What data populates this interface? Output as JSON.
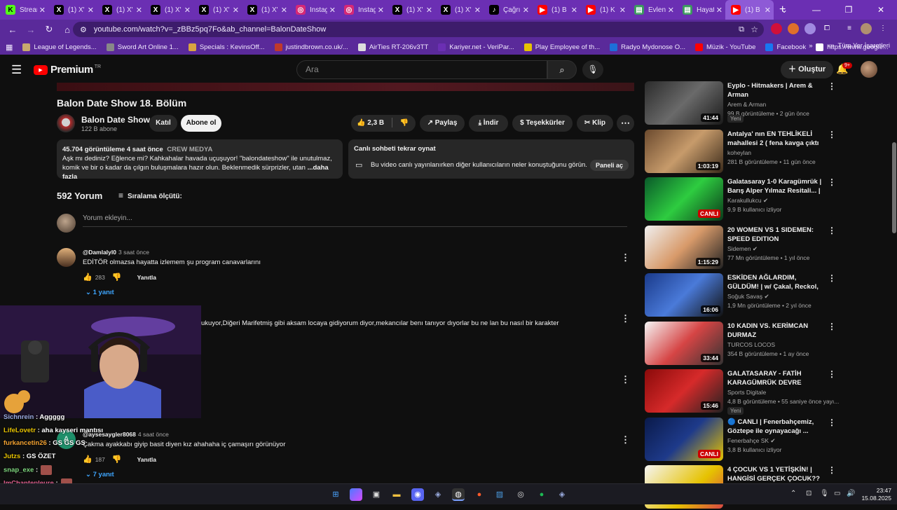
{
  "browser": {
    "tabs": [
      {
        "label": "Stream",
        "icon": "K",
        "color": "#53fc18",
        "fg": "#000"
      },
      {
        "label": "(1) X'",
        "icon": "X",
        "color": "#000",
        "fg": "#fff"
      },
      {
        "label": "(1) X'",
        "icon": "X",
        "color": "#000",
        "fg": "#fff"
      },
      {
        "label": "(1) X'",
        "icon": "X",
        "color": "#000",
        "fg": "#fff"
      },
      {
        "label": "(1) X'",
        "icon": "X",
        "color": "#000",
        "fg": "#fff"
      },
      {
        "label": "(1) X'",
        "icon": "X",
        "color": "#000",
        "fg": "#fff"
      },
      {
        "label": "Instag",
        "icon": "◎",
        "color": "#d62976",
        "fg": "#fff"
      },
      {
        "label": "Instag",
        "icon": "◎",
        "color": "#d62976",
        "fg": "#fff"
      },
      {
        "label": "(1) X'",
        "icon": "X",
        "color": "#000",
        "fg": "#fff"
      },
      {
        "label": "(1) X'",
        "icon": "X",
        "color": "#000",
        "fg": "#fff"
      },
      {
        "label": "Çağrı",
        "icon": "♪",
        "color": "#000",
        "fg": "#fff"
      },
      {
        "label": "(1) B",
        "icon": "▶",
        "color": "#ff0000",
        "fg": "#fff"
      },
      {
        "label": "(1) K",
        "icon": "▶",
        "color": "#ff0000",
        "fg": "#fff"
      },
      {
        "label": "Evlen",
        "icon": "▤",
        "color": "#3c9a5f",
        "fg": "#fff"
      },
      {
        "label": "Hayat",
        "icon": "▤",
        "color": "#3c9a5f",
        "fg": "#fff"
      },
      {
        "label": "(1) B",
        "icon": "▶",
        "color": "#ff0000",
        "fg": "#fff",
        "active": true
      }
    ],
    "url": "youtube.com/watch?v=_zBBz5pq7Fo&ab_channel=BalonDateShow",
    "bookmarks": [
      {
        "label": "League of Legends...",
        "color": "#c8aa6e"
      },
      {
        "label": "Sword Art Online 1...",
        "color": "#888"
      },
      {
        "label": "Specials : KevinsOff...",
        "color": "#d9a441"
      },
      {
        "label": "justindbrown.co.uk/...",
        "color": "#c0392b"
      },
      {
        "label": "AirTies RT-206v3TT",
        "color": "#ddd"
      },
      {
        "label": "Kariyer.net - VeriPar...",
        "color": "#6b2fb3"
      },
      {
        "label": "Play Employee of th...",
        "color": "#e6c200"
      },
      {
        "label": "Radyo Mydonose O...",
        "color": "#1e6fd9"
      },
      {
        "label": "Müzik - YouTube",
        "color": "#ff0000"
      },
      {
        "label": "Facebook",
        "color": "#1877f2"
      },
      {
        "label": "https://www.google...",
        "color": "#fff"
      }
    ],
    "bookmarks_right": "Tüm Yer İşaretleri"
  },
  "youtube": {
    "logo_text": "Premium",
    "logo_region": "TR",
    "search_placeholder": "Ara",
    "create_label": "Oluştur",
    "notif_badge": "9+"
  },
  "video": {
    "title": "Balon Date Show 18. Bölüm",
    "channel": "Balon Date Show",
    "subscribers": "122 B abone",
    "join_label": "Katıl",
    "subscribe_label": "Abone ol",
    "likes": "2,3 B",
    "share_label": "Paylaş",
    "download_label": "İndir",
    "thanks_label": "Teşekkürler",
    "clip_label": "Klip",
    "views": "45.704 görüntüleme",
    "age": "4 saat önce",
    "crew": "CREW MEDYA",
    "desc_line1": "Aşk mı dediniz? Eğlence mi? Kahkahalar havada uçuşuyor! \"balondateshow\" ile unutulmaz,",
    "desc_line2": "komik ve bir o kadar da çılgın buluşmalara hazır olun. Beklenmedik sürprizler, utan",
    "desc_more": "...daha fazla"
  },
  "live_chat": {
    "title": "Canlı sohbeti tekrar oynat",
    "text": "Bu video canlı yayınlanırken diğer kullanıcıların neler konuştuğunu görün.",
    "button": "Paneli aç"
  },
  "comments": {
    "count": "592 Yorum",
    "sort_label": "Sıralama ölçütü:",
    "add_placeholder": "Yorum ekleyin...",
    "items": [
      {
        "user": "@Damlalyl0",
        "time": "3 saat önce",
        "text": "EDİTÖR olmazsa hayatta izlemem şu program canavarlarını",
        "likes": "283",
        "reply": "Yanıtla",
        "replies": "1 yanıt"
      },
      {
        "text": "ukuyor,Diğeri Marifetmiş gibi aksam locaya gidiyorum diyor,mekancılar benı tanıyor dıyorlar bu ne lan bu nasıl bir karakter"
      },
      {
        "user": "@aysesaygler8068",
        "time": "4 saat önce",
        "text": "Çakma ayakkabı giyip basit diyen kız ahahaha iç çamaşırı görünüyor",
        "likes": "187",
        "reply": "Yanıtla",
        "replies": "7 yanıt"
      }
    ]
  },
  "stream_chat": [
    {
      "user": "Sichnrein",
      "msg": ": Aggggg",
      "color": "#9ad"
    },
    {
      "user": "LifeLovetr",
      "msg": ": aha kayseri mantısı",
      "color": "#e6c200"
    },
    {
      "user": "furkancetin26",
      "msg": ": GS GS GS",
      "color": "#f0a030"
    },
    {
      "user": "Jutzs",
      "msg": ": GS ÖZET",
      "color": "#e6c200"
    },
    {
      "user": "snap_exe",
      "msg": ":",
      "color": "#7fd87f"
    },
    {
      "user": "lmChantepleure",
      "msg": ":",
      "color": "#e06090"
    }
  ],
  "sidebar": [
    {
      "title": "Eyplo - Hitmakers | Arem & Arman",
      "channel": "Arem & Arman",
      "meta": "99 B görüntüleme • 2 gün önce",
      "duration": "41:44",
      "badge": "",
      "thumb": "linear-gradient(135deg,#2b2b2b,#6a6a6a 50%,#1a1a1a)"
    },
    {
      "title": "Antalya' nın EN TEHLİKELİ mahallesi 2 ( fena kavga çıktı ...",
      "channel": "koheylan",
      "meta": "281 B görüntüleme • 11 gün önce",
      "duration": "1:03:19",
      "badge": "",
      "thumb": "linear-gradient(135deg,#6b4a2e,#c79b6b 50%,#3a2a1a)"
    },
    {
      "title": "Galatasaray 1-0 Karagümrük | Barış Alper Yılmaz Resitali... | ...",
      "channel": "Karakullukcu ✔",
      "meta": "9,9 B kullanıcı izliyor",
      "duration": "CANLI",
      "live": true,
      "badge": "",
      "thumb": "linear-gradient(135deg,#0a5a2a,#2ecc40 50%,#0a3a1a)"
    },
    {
      "title": "20 WOMEN VS 1 SIDEMEN: SPEED EDITION",
      "channel": "Sidemen ✔",
      "meta": "77 Mn görüntüleme • 1 yıl önce",
      "duration": "1:15:29",
      "badge": "",
      "thumb": "linear-gradient(135deg,#f0f0f0,#d89a6a 50%,#222)"
    },
    {
      "title": "ESKİDEN AĞLARDIM, GÜLDÜM! | w/ Çakal, Reckol, Ege Boran ...",
      "channel": "Soğuk Savaş ✔",
      "meta": "1,9 Mn görüntüleme • 2 yıl önce",
      "duration": "16:06",
      "badge": "",
      "thumb": "linear-gradient(135deg,#1a3a8a,#4a7ad9 50%,#111)"
    },
    {
      "title": "10 KADIN VS. KERİMCAN DURMAZ",
      "channel": "TURCOS LOCOS",
      "meta": "354 B görüntüleme • 1 ay önce",
      "duration": "33:44",
      "badge": "",
      "thumb": "linear-gradient(135deg,#f5f5f5,#d64545 50%,#333)"
    },
    {
      "title": "GALATASARAY - FATİH KARAGÜMRÜK DEVRE ARASI ...",
      "channel": "Sports Digitale",
      "meta": "4,8 B görüntüleme • 55 saniye önce yayı...",
      "duration": "15:46",
      "badge": "Yeni",
      "thumb": "linear-gradient(135deg,#8a0a0a,#d62a2a 50%,#222)"
    },
    {
      "title": "🔵 CANLI | Fenerbahçemiz, Göztepe ile oynayacağı ...",
      "channel": "Fenerbahçe SK ✔",
      "meta": "3,8 B kullanıcı izliyor",
      "duration": "CANLI",
      "live": true,
      "badge": "",
      "thumb": "linear-gradient(135deg,#0a1a4a,#1e3a8a 50%,#e6c200)"
    },
    {
      "title": "4 ÇOCUK VS 1 YETİŞKİN! | HANGİSİ GERÇEK ÇOCUK??",
      "channel": "",
      "meta": "",
      "duration": "",
      "badge": "",
      "thumb": "linear-gradient(135deg,#f5f5f5,#e6c200 60%,#d64545)"
    }
  ],
  "sidebar_first_badge": "Yeni",
  "taskbar": {
    "time": "23:47",
    "date": "15.08.2025"
  }
}
